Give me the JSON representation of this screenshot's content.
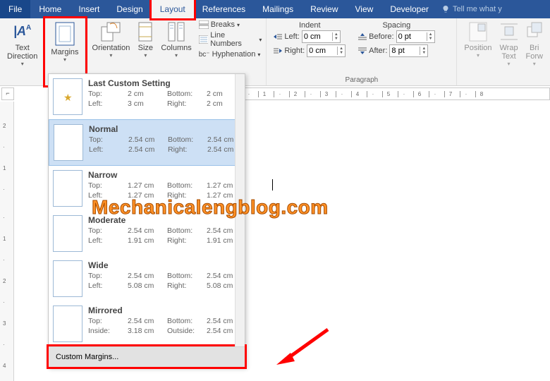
{
  "tabs": {
    "file": "File",
    "home": "Home",
    "insert": "Insert",
    "design": "Design",
    "layout": "Layout",
    "references": "References",
    "mailings": "Mailings",
    "review": "Review",
    "view": "View",
    "developer": "Developer",
    "tell": "Tell me what y"
  },
  "ribbon": {
    "text_direction": "Text\nDirection",
    "margins": "Margins",
    "orientation": "Orientation",
    "size": "Size",
    "columns": "Columns",
    "breaks": "Breaks",
    "line_numbers": "Line Numbers",
    "hyphenation": "Hyphenation",
    "indent_title": "Indent",
    "spacing_title": "Spacing",
    "left_lbl": "Left:",
    "right_lbl": "Right:",
    "before_lbl": "Before:",
    "after_lbl": "After:",
    "left_val": "0 cm",
    "right_val": "0 cm",
    "before_val": "0 pt",
    "after_val": "8 pt",
    "paragraph": "Paragraph",
    "position": "Position",
    "wrap_text": "Wrap\nText",
    "bring": "Bri\nForw"
  },
  "dropdown": {
    "items": [
      {
        "name": "Last Custom Setting",
        "top": "2 cm",
        "bottom": "2 cm",
        "left": "3 cm",
        "right": "2 cm",
        "l1": "Top:",
        "l2": "Left:",
        "l3": "Bottom:",
        "l4": "Right:"
      },
      {
        "name": "Normal",
        "top": "2.54 cm",
        "bottom": "2.54 cm",
        "left": "2.54 cm",
        "right": "2.54 cm",
        "l1": "Top:",
        "l2": "Left:",
        "l3": "Bottom:",
        "l4": "Right:"
      },
      {
        "name": "Narrow",
        "top": "1.27 cm",
        "bottom": "1.27 cm",
        "left": "1.27 cm",
        "right": "1.27 cm",
        "l1": "Top:",
        "l2": "Left:",
        "l3": "Bottom:",
        "l4": "Right:"
      },
      {
        "name": "Moderate",
        "top": "2.54 cm",
        "bottom": "2.54 cm",
        "left": "1.91 cm",
        "right": "1.91 cm",
        "l1": "Top:",
        "l2": "Left:",
        "l3": "Bottom:",
        "l4": "Right:"
      },
      {
        "name": "Wide",
        "top": "2.54 cm",
        "bottom": "2.54 cm",
        "left": "5.08 cm",
        "right": "5.08 cm",
        "l1": "Top:",
        "l2": "Left:",
        "l3": "Bottom:",
        "l4": "Right:"
      },
      {
        "name": "Mirrored",
        "top": "2.54 cm",
        "bottom": "2.54 cm",
        "left": "3.18 cm",
        "right": "2.54 cm",
        "l1": "Top:",
        "l2": "Inside:",
        "l3": "Bottom:",
        "l4": "Outside:"
      }
    ],
    "custom": "Custom Margins..."
  },
  "watermark": "Mechanicalengblog.com",
  "ruler_corner": "⌐"
}
